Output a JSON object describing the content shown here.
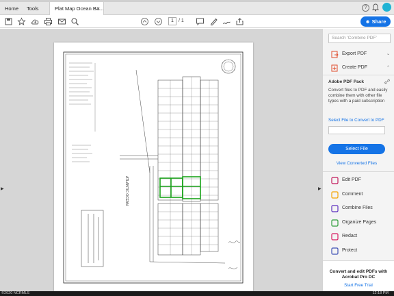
{
  "tabs": {
    "home": "Home",
    "tools": "Tools",
    "document": "Plat Map Ocean Ba...",
    "close": "×"
  },
  "toolbar": {
    "page_current": "1",
    "page_total": "/ 1",
    "share": "Share"
  },
  "help": "?",
  "right_panel": {
    "search_placeholder": "Search 'Combine PDF'",
    "export_pdf": "Export PDF",
    "create_pdf": "Create PDF",
    "chevron": "⌄",
    "pack_title": "Adobe PDF Pack",
    "pack_desc": "Convert files to PDF and easily combine them with other file types with a paid subscription",
    "convert_label": "Select File to Convert to PDF",
    "select_file": "Select File",
    "view_converted": "View Converted Files",
    "tools": [
      {
        "label": "Edit PDF",
        "icon": "edit-pdf-icon",
        "color": "#c2185b"
      },
      {
        "label": "Comment",
        "icon": "comment-icon",
        "color": "#f4a300"
      },
      {
        "label": "Combine Files",
        "icon": "combine-files-icon",
        "color": "#5c2fbf"
      },
      {
        "label": "Organize Pages",
        "icon": "organize-pages-icon",
        "color": "#2e9d3a"
      },
      {
        "label": "Redact",
        "icon": "redact-icon",
        "color": "#d81b60"
      },
      {
        "label": "Protect",
        "icon": "protect-icon",
        "color": "#3f51b5"
      }
    ],
    "promo_text": "Convert and edit PDFs with Acrobat Pro DC",
    "promo_link": "Start Free Trial"
  },
  "footer": {
    "copyright": "©2020 NCRMLS",
    "clock": "12:18 PM"
  },
  "colors": {
    "accent": "#1473e6",
    "highlight": "#1aa31a"
  }
}
